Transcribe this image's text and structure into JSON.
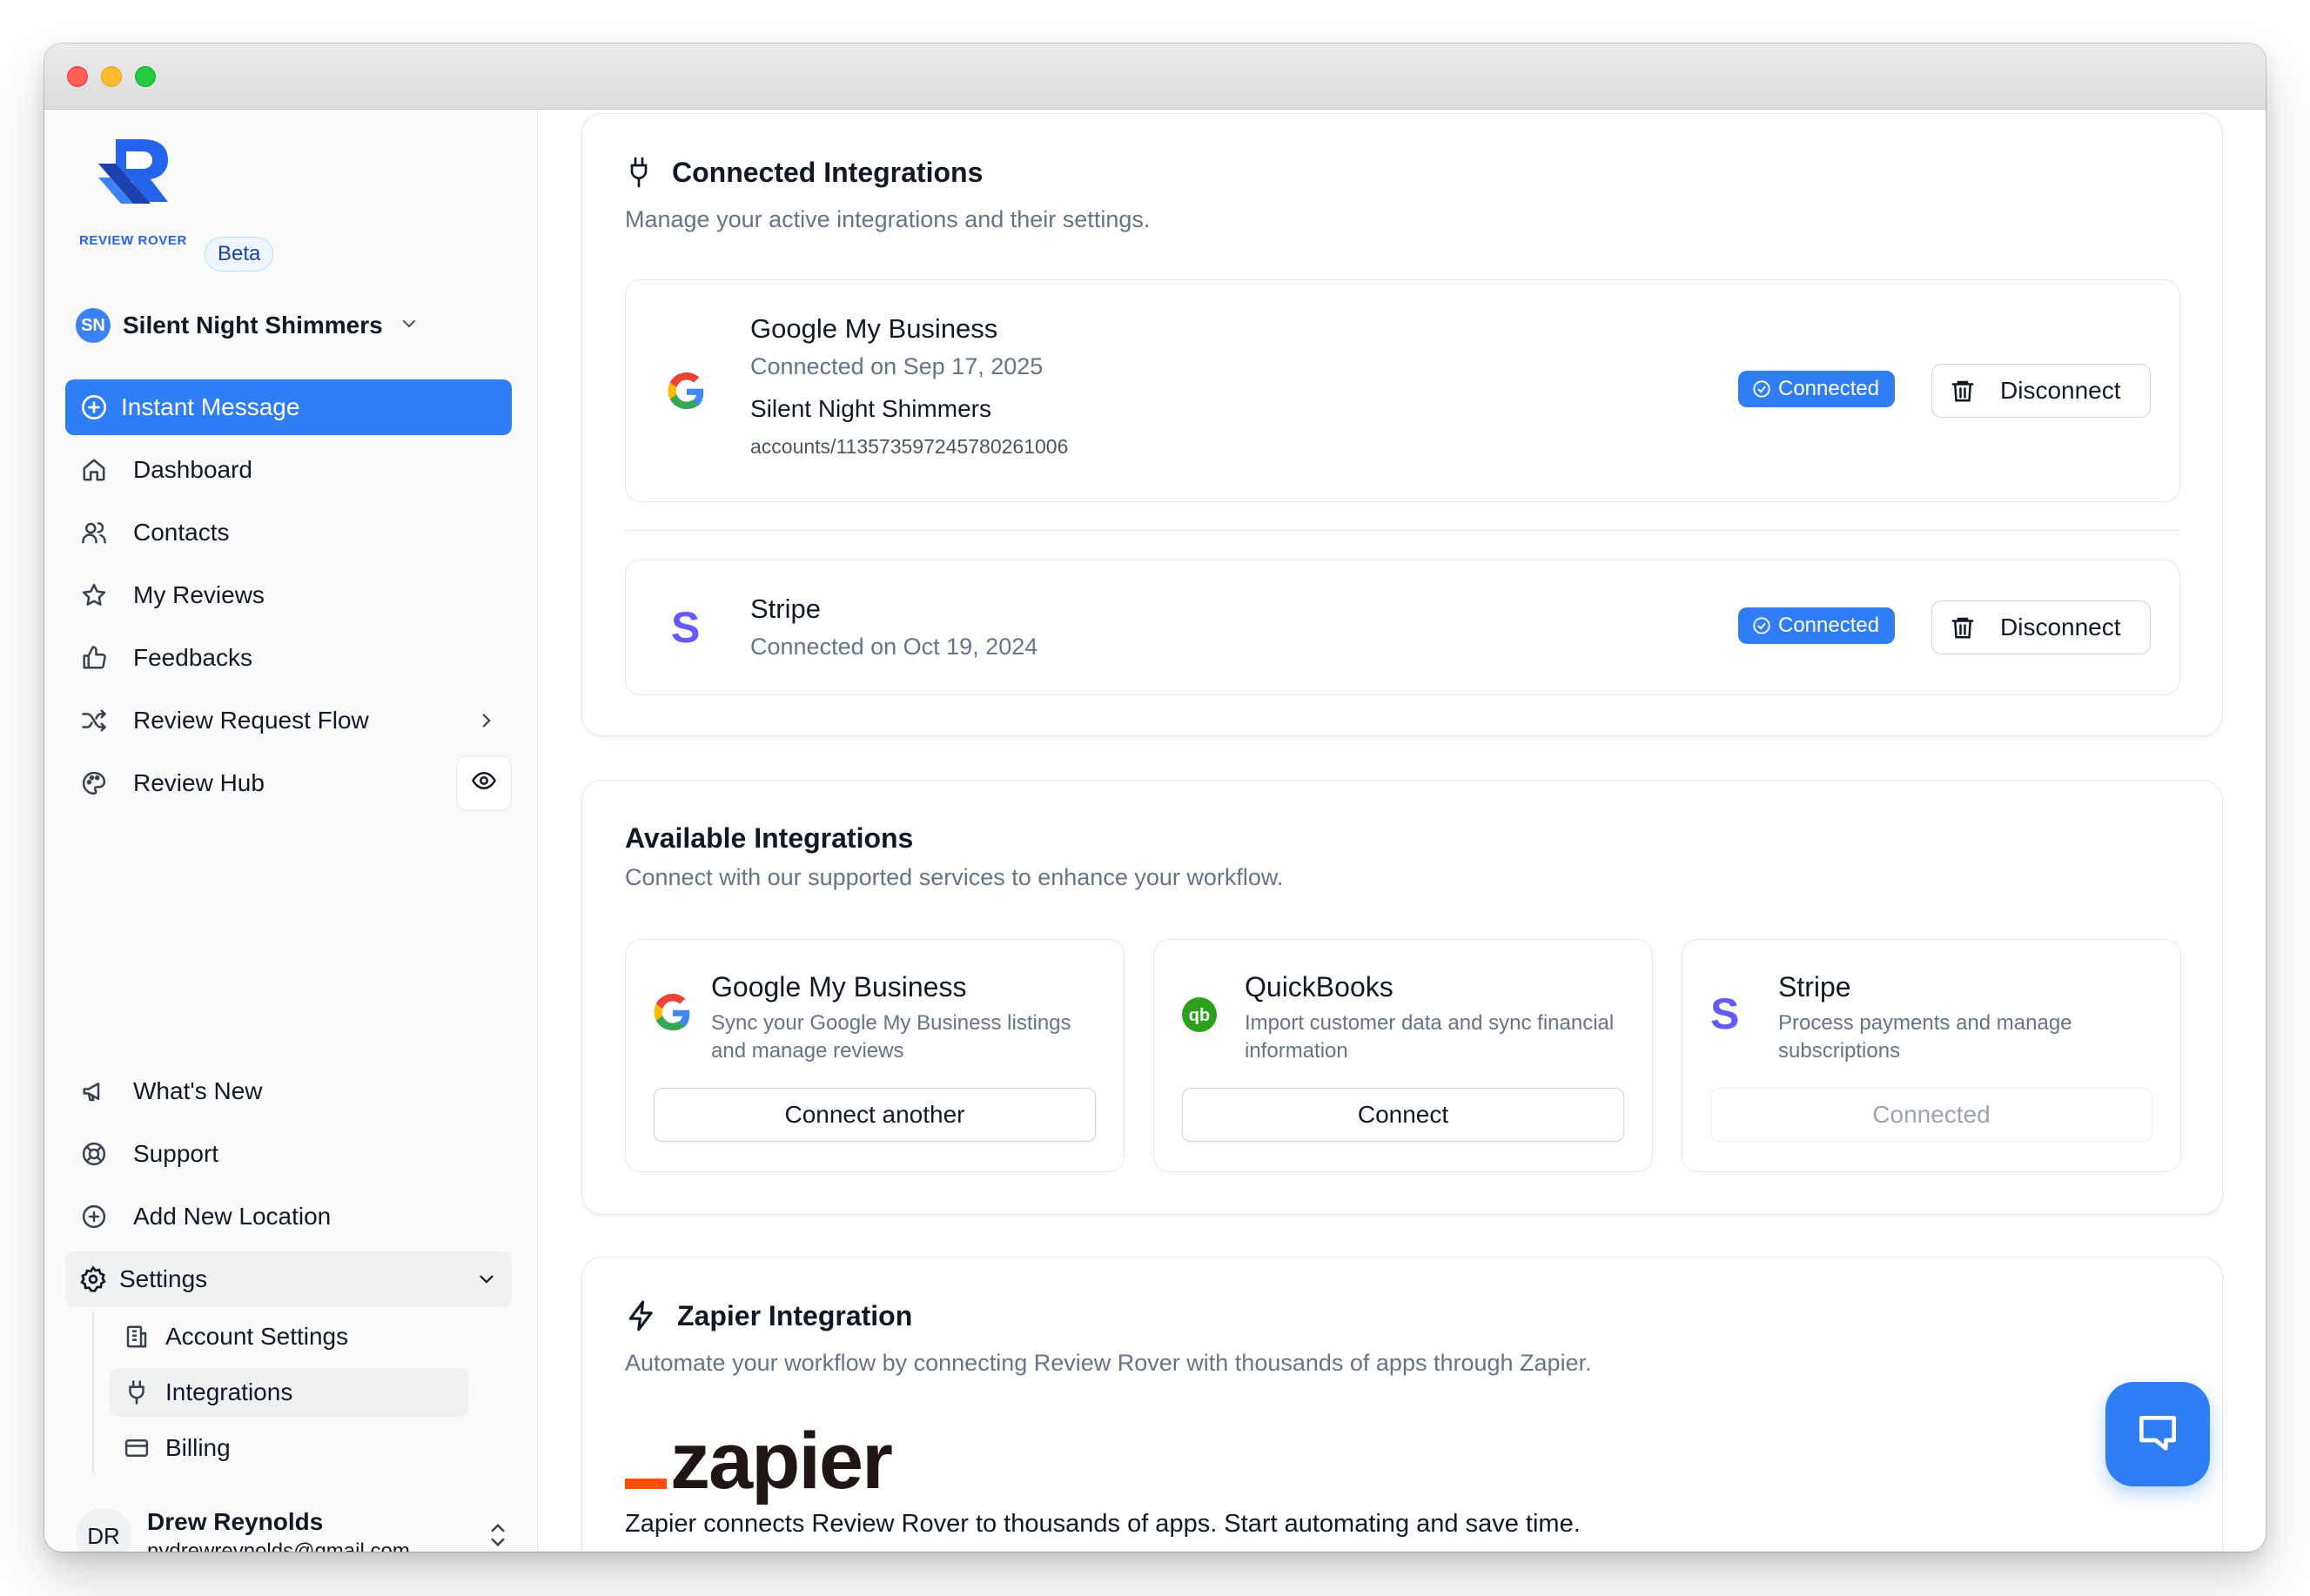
{
  "window": {
    "controls": [
      "close",
      "minimize",
      "zoom"
    ]
  },
  "brand": {
    "logo_text": "REVIEW ROVER",
    "badge": "Beta",
    "accent": "#2f7ef5"
  },
  "location": {
    "initials": "SN",
    "name": "Silent Night Shimmers"
  },
  "nav": {
    "instant_message": "Instant Message",
    "dashboard": "Dashboard",
    "contacts": "Contacts",
    "my_reviews": "My Reviews",
    "feedbacks": "Feedbacks",
    "review_request_flow": "Review Request Flow",
    "review_hub": "Review Hub",
    "whats_new": "What's New",
    "support": "Support",
    "add_new_location": "Add New Location",
    "settings": "Settings",
    "account_settings": "Account Settings",
    "integrations": "Integrations",
    "billing": "Billing"
  },
  "user": {
    "initials": "DR",
    "name": "Drew Reynolds",
    "email": "nydrewreynolds@gmail.com"
  },
  "connected": {
    "title": "Connected Integrations",
    "subtitle": "Manage your active integrations and their settings.",
    "items": [
      {
        "name": "Google My Business",
        "date": "Connected on Sep 17, 2025",
        "account": "Silent Night Shimmers",
        "account_id": "accounts/113573597245780261006",
        "status": "Connected",
        "action": "Disconnect"
      },
      {
        "name": "Stripe",
        "date": "Connected on Oct 19, 2024",
        "status": "Connected",
        "action": "Disconnect"
      }
    ]
  },
  "available": {
    "title": "Available Integrations",
    "subtitle": "Connect with our supported services to enhance your workflow.",
    "items": [
      {
        "name": "Google My Business",
        "desc": "Sync your Google My Business listings and manage reviews",
        "button": "Connect another",
        "icon": "google-icon"
      },
      {
        "name": "QuickBooks",
        "desc": "Import customer data and sync financial information",
        "button": "Connect",
        "icon": "quickbooks-icon"
      },
      {
        "name": "Stripe",
        "desc": "Process payments and manage subscriptions",
        "button": "Connected",
        "icon": "stripe-icon",
        "disabled": true
      }
    ]
  },
  "zapier": {
    "title": "Zapier Integration",
    "subtitle": "Automate your workflow by connecting Review Rover with thousands of apps through Zapier.",
    "logo_text": "zapier",
    "desc": "Zapier connects Review Rover to thousands of apps. Start automating and save time."
  }
}
